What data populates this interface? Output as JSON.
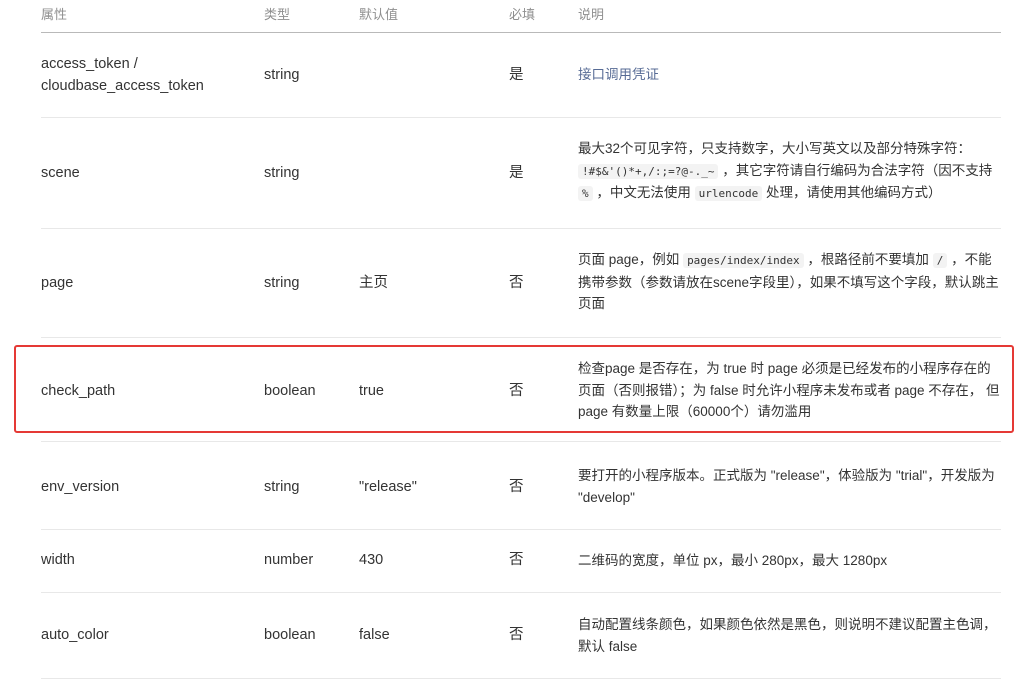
{
  "table": {
    "headers": [
      "属性",
      "类型",
      "默认值",
      "必填",
      "说明"
    ],
    "rows": [
      {
        "name_line1": "access_token /",
        "name_line2": "cloudbase_access_token",
        "type": "string",
        "default": "",
        "required": "是",
        "desc": "接口调用凭证"
      },
      {
        "name": "scene",
        "type": "string",
        "default": "",
        "required": "是",
        "desc_a": "最大32个可见字符，只支持数字，大小写英文以及部分特殊字符：",
        "code1": "!#$&'()*+,/:;=?@-._~",
        "desc_b": "，其它字符请自行编码为合法字符（因不支持",
        "code2": "%",
        "desc_c": "，中文无法使用",
        "code3": "urlencode",
        "desc_d": "处理，请使用其他编码方式）"
      },
      {
        "name": "page",
        "type": "string",
        "default": "主页",
        "required": "否",
        "desc_a": "页面 page，例如",
        "code1": "pages/index/index",
        "desc_b": "，根路径前不要填加",
        "code2": "/",
        "desc_c": "，不能携带参数（参数请放在scene字段里），如果不填写这个字段，默认跳主页面"
      },
      {
        "name": "check_path",
        "type": "boolean",
        "default": "true",
        "required": "否",
        "desc": "检查page 是否存在，为 true 时 page 必须是已经发布的小程序存在的页面（否则报错）；为 false 时允许小程序未发布或者 page 不存在， 但page 有数量上限（60000个）请勿滥用"
      },
      {
        "name": "env_version",
        "type": "string",
        "default": "\"release\"",
        "required": "否",
        "desc": "要打开的小程序版本。正式版为 \"release\"，体验版为 \"trial\"，开发版为 \"develop\""
      },
      {
        "name": "width",
        "type": "number",
        "default": "430",
        "required": "否",
        "desc": "二维码的宽度，单位 px，最小 280px，最大 1280px"
      },
      {
        "name": "auto_color",
        "type": "boolean",
        "default": "false",
        "required": "否",
        "desc": "自动配置线条颜色，如果颜色依然是黑色，则说明不建议配置主色调，默认 false"
      }
    ]
  },
  "colors": {
    "highlight_border": "#e53935",
    "link": "#576b95",
    "header_text": "#8f8f8f"
  }
}
